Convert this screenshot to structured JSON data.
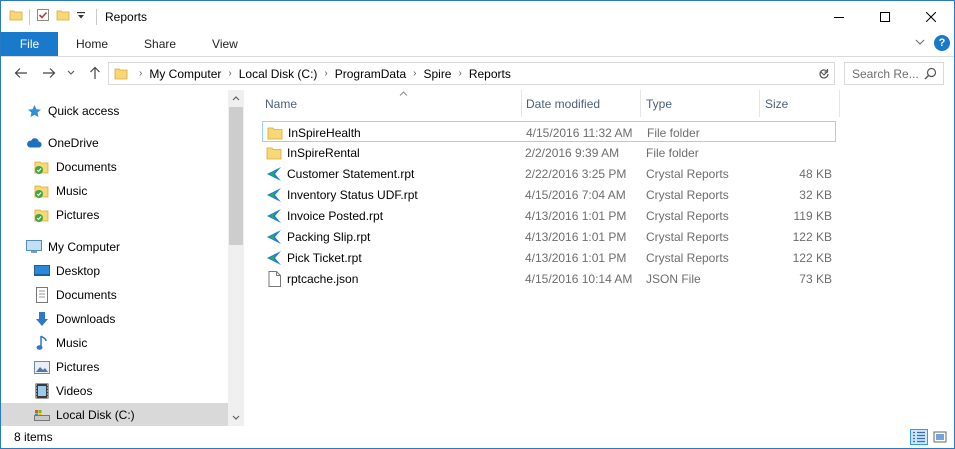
{
  "window": {
    "title": "Reports",
    "accent": "#1979ca"
  },
  "ribbon": {
    "tabs": [
      "File",
      "Home",
      "Share",
      "View"
    ]
  },
  "address": {
    "crumbs": [
      "My Computer",
      "Local Disk (C:)",
      "ProgramData",
      "Spire",
      "Reports"
    ]
  },
  "search": {
    "placeholder": "Search Re..."
  },
  "navpane": {
    "items": [
      {
        "label": "Quick access",
        "icon": "star-icon"
      },
      {
        "label": "OneDrive",
        "icon": "cloud-icon"
      },
      {
        "label": "Documents",
        "icon": "folder-synced-icon"
      },
      {
        "label": "Music",
        "icon": "folder-synced-icon"
      },
      {
        "label": "Pictures",
        "icon": "folder-synced-icon"
      },
      {
        "label": "My Computer",
        "icon": "computer-icon"
      },
      {
        "label": "Desktop",
        "icon": "desktop-icon"
      },
      {
        "label": "Documents",
        "icon": "documents-icon"
      },
      {
        "label": "Downloads",
        "icon": "download-icon"
      },
      {
        "label": "Music",
        "icon": "music-note-icon"
      },
      {
        "label": "Pictures",
        "icon": "pictures-icon"
      },
      {
        "label": "Videos",
        "icon": "film-icon"
      },
      {
        "label": "Local Disk (C:)",
        "icon": "drive-icon"
      }
    ]
  },
  "columns": [
    "Name",
    "Date modified",
    "Type",
    "Size"
  ],
  "files": [
    {
      "name": "InSpireHealth",
      "date": "4/15/2016 11:32 AM",
      "type": "File folder",
      "size": "",
      "icon": "folder-icon"
    },
    {
      "name": "InSpireRental",
      "date": "2/2/2016 9:39 AM",
      "type": "File folder",
      "size": "",
      "icon": "folder-icon"
    },
    {
      "name": "Customer Statement.rpt",
      "date": "2/22/2016 3:25 PM",
      "type": "Crystal Reports",
      "size": "48 KB",
      "icon": "crystal-reports-icon"
    },
    {
      "name": "Inventory Status UDF.rpt",
      "date": "4/15/2016 7:04 AM",
      "type": "Crystal Reports",
      "size": "32 KB",
      "icon": "crystal-reports-icon"
    },
    {
      "name": "Invoice Posted.rpt",
      "date": "4/13/2016 1:01 PM",
      "type": "Crystal Reports",
      "size": "119 KB",
      "icon": "crystal-reports-icon"
    },
    {
      "name": "Packing Slip.rpt",
      "date": "4/13/2016 1:01 PM",
      "type": "Crystal Reports",
      "size": "122 KB",
      "icon": "crystal-reports-icon"
    },
    {
      "name": "Pick Ticket.rpt",
      "date": "4/13/2016 1:01 PM",
      "type": "Crystal Reports",
      "size": "122 KB",
      "icon": "crystal-reports-icon"
    },
    {
      "name": "rptcache.json",
      "date": "4/15/2016 10:14 AM",
      "type": "JSON File",
      "size": "73 KB",
      "icon": "json-file-icon"
    }
  ],
  "status": {
    "count": "8 items"
  }
}
